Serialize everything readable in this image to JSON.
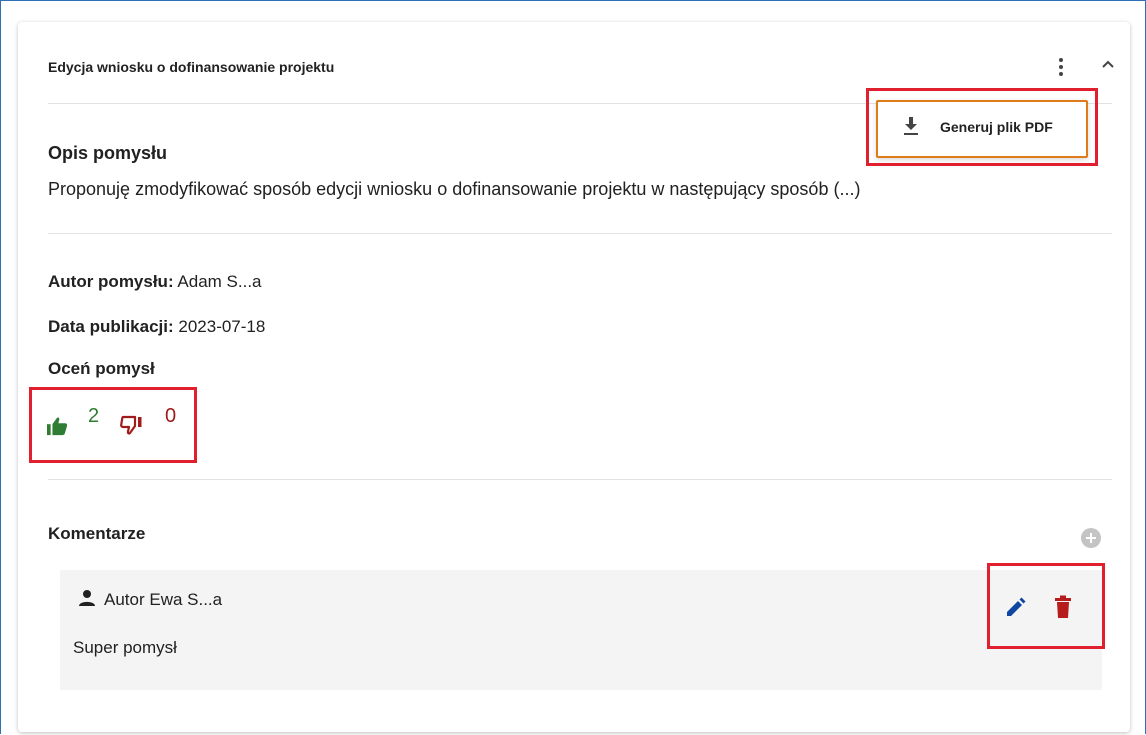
{
  "card": {
    "title": "Edycja wniosku o dofinansowanie projektu",
    "menu_item_label": "Generuj plik PDF"
  },
  "idea": {
    "description_heading": "Opis pomysłu",
    "description_text": "Proponuję zmodyfikować sposób edycji wniosku o dofinansowanie projektu w następujący sposób (...)",
    "author_label": "Autor pomysłu:",
    "author_value": "Adam S...a",
    "date_label": "Data publikacji:",
    "date_value": "2023-07-18",
    "rate_heading": "Oceń pomysł",
    "likes": "2",
    "dislikes": "0"
  },
  "comments": {
    "heading": "Komentarze",
    "items": [
      {
        "author": "Autor Ewa S...a",
        "text": "Super pomysł"
      }
    ]
  },
  "icons": {
    "menu": "more-vert-icon",
    "collapse": "chevron-up-icon",
    "download": "download-icon",
    "like": "thumb-up-icon",
    "dislike": "thumb-down-icon",
    "add": "add-circle-icon",
    "user": "person-icon",
    "edit": "pencil-icon",
    "delete": "trash-icon"
  },
  "colors": {
    "accent_blue": "#0d47a1",
    "like_green": "#2e7d32",
    "dislike_red": "#a11b1b",
    "highlight_red": "#e0202e",
    "menu_border_orange": "#e07b1a"
  }
}
